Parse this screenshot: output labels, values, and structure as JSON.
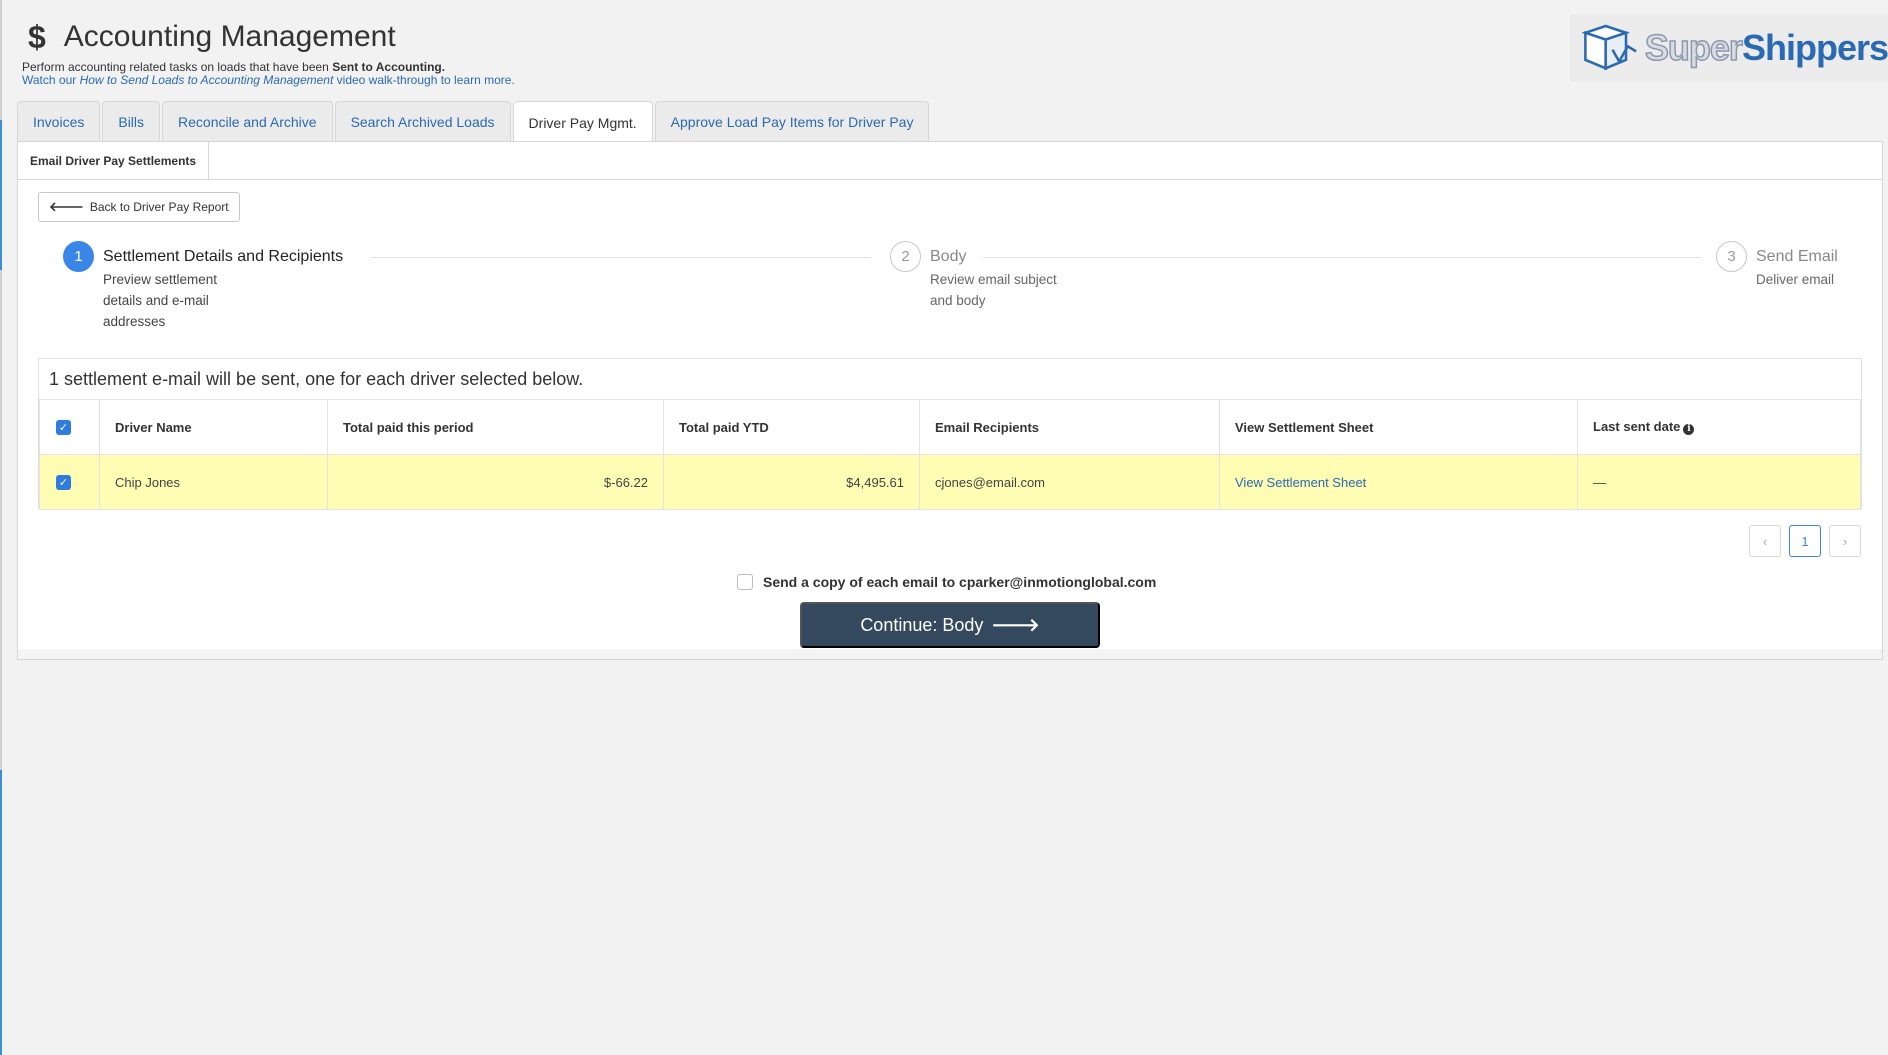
{
  "header": {
    "title": "Accounting Management",
    "subtitle_prefix": "Perform accounting related tasks on loads that have been",
    "subtitle_bold": "Sent to Accounting.",
    "walkthrough_prefix": "Watch our",
    "walkthrough_link": "How to Send Loads to Accounting Management",
    "walkthrough_suffix": "video walk-through to learn more."
  },
  "logo": {
    "part1": "Super",
    "part2": "Shippers"
  },
  "tabs": [
    {
      "label": "Invoices"
    },
    {
      "label": "Bills"
    },
    {
      "label": "Reconcile and Archive"
    },
    {
      "label": "Search Archived Loads"
    },
    {
      "label": "Driver Pay Mgmt.",
      "active": true
    },
    {
      "label": "Approve Load Pay Items for Driver Pay"
    }
  ],
  "subtab": {
    "label": "Email Driver Pay Settlements"
  },
  "back_button": {
    "label": "Back to Driver Pay Report"
  },
  "steps": [
    {
      "number": "1",
      "title": "Settlement Details and Recipients",
      "desc1": "Preview settlement",
      "desc2": "details and e-mail",
      "desc3": "addresses"
    },
    {
      "number": "2",
      "title": "Body",
      "desc1": "Review email subject",
      "desc2": "and body"
    },
    {
      "number": "3",
      "title": "Send Email",
      "desc1": "Deliver email"
    }
  ],
  "table": {
    "summary": "1 settlement e-mail will be sent, one for each driver selected below.",
    "columns": [
      "Driver Name",
      "Total paid this period",
      "Total paid YTD",
      "Email Recipients",
      "View Settlement Sheet",
      "Last sent date"
    ],
    "rows": [
      {
        "driver": "Chip Jones",
        "period": "$-66.22",
        "ytd": "$4,495.61",
        "email": "cjones@email.com",
        "sheet": "View Settlement Sheet",
        "last_sent": "—"
      }
    ]
  },
  "pagination": {
    "prev": "‹",
    "page": "1",
    "next": "›"
  },
  "copy_option": {
    "label": "Send a copy of each email to cparker@inmotionglobal.com"
  },
  "continue_button": {
    "label": "Continue: Body"
  },
  "colors": {
    "accent": "#3a85e8",
    "link": "#2a6ab3",
    "primary_button": "#34495e",
    "selected_row": "#fffcb3"
  }
}
